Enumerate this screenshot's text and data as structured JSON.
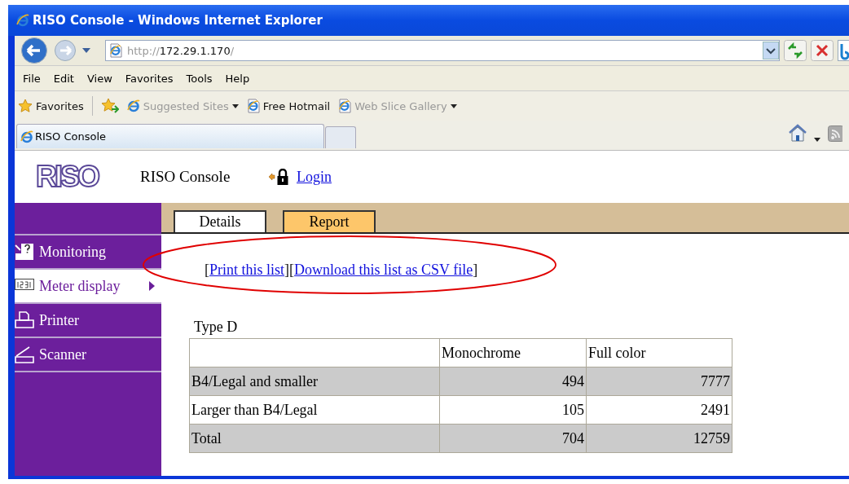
{
  "window": {
    "title": "RISO Console - Windows Internet Explorer"
  },
  "address_bar": {
    "scheme": "http://",
    "host": "172.29.1.170",
    "path": "/"
  },
  "menu": [
    "File",
    "Edit",
    "View",
    "Favorites",
    "Tools",
    "Help"
  ],
  "favorites_bar": [
    {
      "kind": "favorites",
      "label": "Favorites",
      "dimmed": false,
      "dropdown": false
    },
    {
      "kind": "page",
      "label": "Suggested Sites",
      "dimmed": true,
      "dropdown": true
    },
    {
      "kind": "page",
      "label": "Free Hotmail",
      "dimmed": false,
      "dropdown": false
    },
    {
      "kind": "page",
      "label": "Web Slice Gallery",
      "dimmed": true,
      "dropdown": true
    }
  ],
  "browser_tabs": [
    {
      "label": "RISO Console",
      "selected": true
    }
  ],
  "page": {
    "logo": "RISO",
    "title": "RISO Console",
    "login_link": "Login",
    "sidebar": [
      {
        "kind": "monitor",
        "label": "Monitoring",
        "selected": false
      },
      {
        "kind": "meter",
        "label": "Meter display",
        "selected": true
      },
      {
        "kind": "printer",
        "label": "Printer",
        "selected": false
      },
      {
        "kind": "scanner",
        "label": "Scanner",
        "selected": false
      }
    ],
    "tabs": [
      {
        "label": "Details",
        "selected": false
      },
      {
        "label": "Report",
        "selected": true
      }
    ],
    "links": [
      {
        "open": "[",
        "label": "Print this list",
        "close": "]"
      },
      {
        "open": "[",
        "label": "Download this list as CSV file",
        "close": "]"
      }
    ],
    "section_title": "Type D",
    "table": {
      "columns": [
        "Monochrome",
        "Full color"
      ],
      "rows": [
        {
          "label": "B4/Legal and smaller",
          "shaded": true,
          "values": [
            "494",
            "7777"
          ]
        },
        {
          "label": "Larger than B4/Legal",
          "shaded": false,
          "values": [
            "105",
            "2491"
          ]
        },
        {
          "label": "Total",
          "shaded": true,
          "values": [
            "704",
            "12759"
          ]
        }
      ]
    }
  }
}
